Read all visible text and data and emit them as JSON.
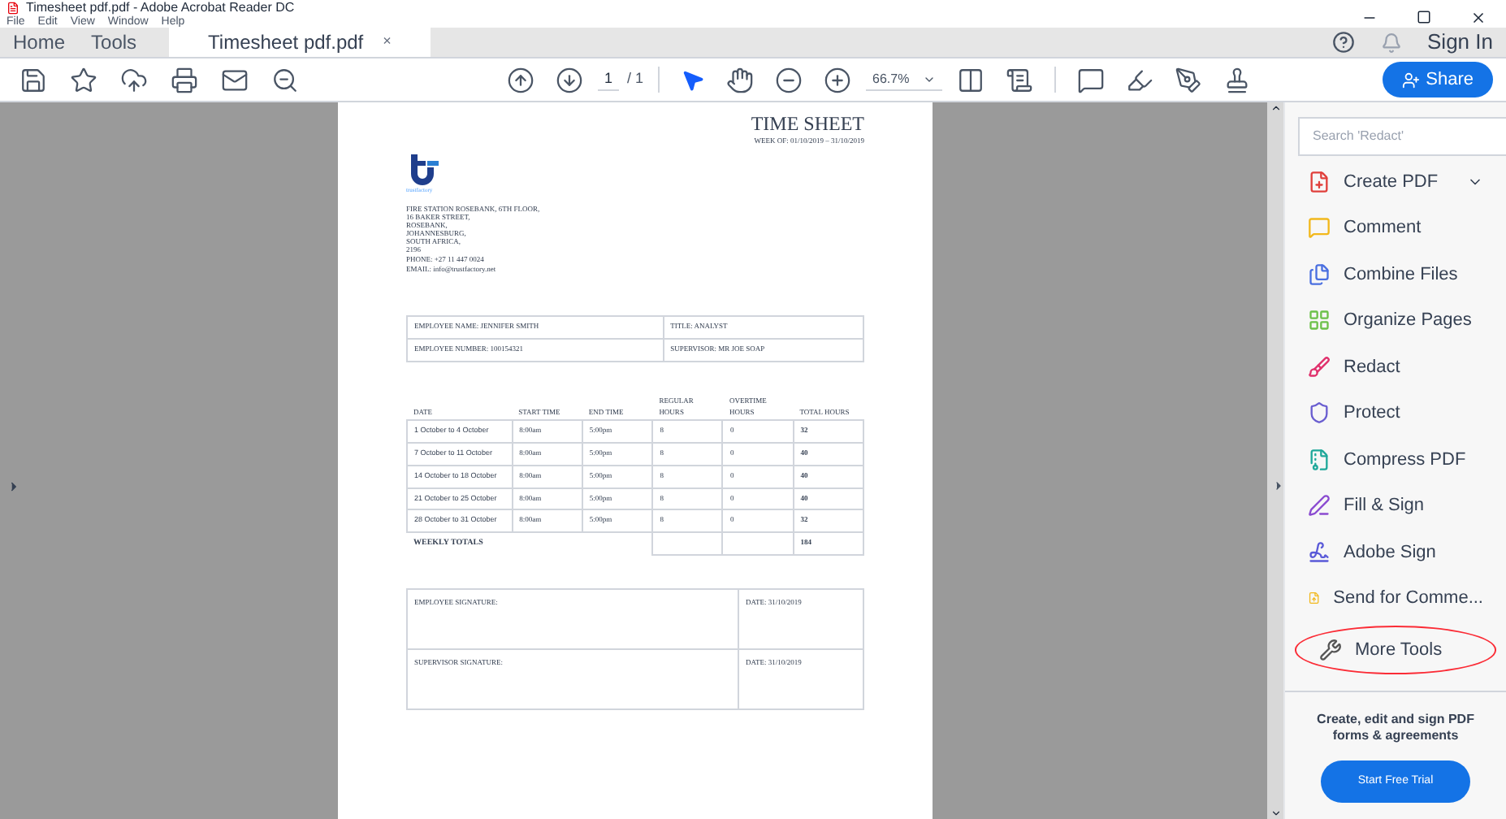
{
  "window": {
    "title": "Timesheet pdf.pdf - Adobe Acrobat Reader DC"
  },
  "menu": [
    "File",
    "Edit",
    "View",
    "Window",
    "Help"
  ],
  "tabs": [
    {
      "label": "Home",
      "selected": false
    },
    {
      "label": "Tools",
      "selected": false
    },
    {
      "label": "Timesheet pdf.pdf",
      "selected": true,
      "close": "×"
    }
  ],
  "account": {
    "sign_in": "Sign In"
  },
  "toolbar": {
    "page": "1",
    "page_total": "/ 1",
    "zoom": "66.7%",
    "share": "Share"
  },
  "document": {
    "title": "TIME SHEET",
    "week": "WEEK OF: 01/10/2019 – 31/10/2019",
    "logo_caption": "trustfactory",
    "address": [
      "FIRE STATION ROSEBANK, 6TH FLOOR,",
      "16 BAKER STREET,",
      "ROSEBANK,",
      "JOHANNESBURG,",
      "SOUTH AFRICA,",
      "2196"
    ],
    "phone": "PHONE: +27 11 447 0024",
    "email": "EMAIL: info@trustfactory.net",
    "info": [
      [
        "EMPLOYEE NAME: JENNIFER SMITH",
        "TITLE: ANALYST"
      ],
      [
        "EMPLOYEE NUMBER: 100154321",
        "SUPERVISOR: MR JOE SOAP"
      ]
    ],
    "table": {
      "columns": [
        "DATE",
        "START TIME",
        "END TIME",
        "REGULAR HOURS",
        "OVERTIME HOURS",
        "TOTAL HOURS"
      ],
      "rows": [
        [
          "1 October to 4 October",
          "8:00am",
          "5:00pm",
          "8",
          "0",
          "32"
        ],
        [
          "7 October to 11 October",
          "8:00am",
          "5:00pm",
          "8",
          "0",
          "40"
        ],
        [
          "14 October to 18 October",
          "8:00am",
          "5:00pm",
          "8",
          "0",
          "40"
        ],
        [
          "21 October to 25 October",
          "8:00am",
          "5:00pm",
          "8",
          "0",
          "40"
        ],
        [
          "28 October to 31 October",
          "8:00am",
          "5:00pm",
          "8",
          "0",
          "32"
        ]
      ],
      "totals_label": "WEEKLY TOTALS",
      "totals_value": "184"
    },
    "signatures": [
      [
        "EMPLOYEE SIGNATURE:",
        "DATE: 31/10/2019"
      ],
      [
        "SUPERVISOR SIGNATURE:",
        "DATE: 31/10/2019"
      ]
    ]
  },
  "tools_panel": {
    "search": {
      "placeholder": "Search 'Redact'"
    },
    "items": [
      {
        "label": "Create PDF",
        "color": "#e0403c",
        "expandable": true,
        "circled": false
      },
      {
        "label": "Comment",
        "color": "#f2b81c",
        "expandable": false,
        "circled": false
      },
      {
        "label": "Combine Files",
        "color": "#4a6fe0",
        "expandable": false,
        "circled": false
      },
      {
        "label": "Organize Pages",
        "color": "#6cc04a",
        "expandable": false,
        "circled": false
      },
      {
        "label": "Redact",
        "color": "#e0306c",
        "expandable": false,
        "circled": false
      },
      {
        "label": "Protect",
        "color": "#6a5ed0",
        "expandable": false,
        "circled": false
      },
      {
        "label": "Compress PDF",
        "color": "#1fa89a",
        "expandable": false,
        "circled": false
      },
      {
        "label": "Fill & Sign",
        "color": "#8a4ad0",
        "expandable": false,
        "circled": false
      },
      {
        "label": "Adobe Sign",
        "color": "#5a5ad8",
        "expandable": false,
        "circled": false
      },
      {
        "label": "Send for Comme...",
        "color": "#f2b81c",
        "expandable": false,
        "circled": false
      },
      {
        "label": "More Tools",
        "color": "#555555",
        "expandable": false,
        "circled": true
      }
    ],
    "promo": "Create, edit and sign PDF forms & agreements",
    "trial_button": "Start Free Trial"
  }
}
